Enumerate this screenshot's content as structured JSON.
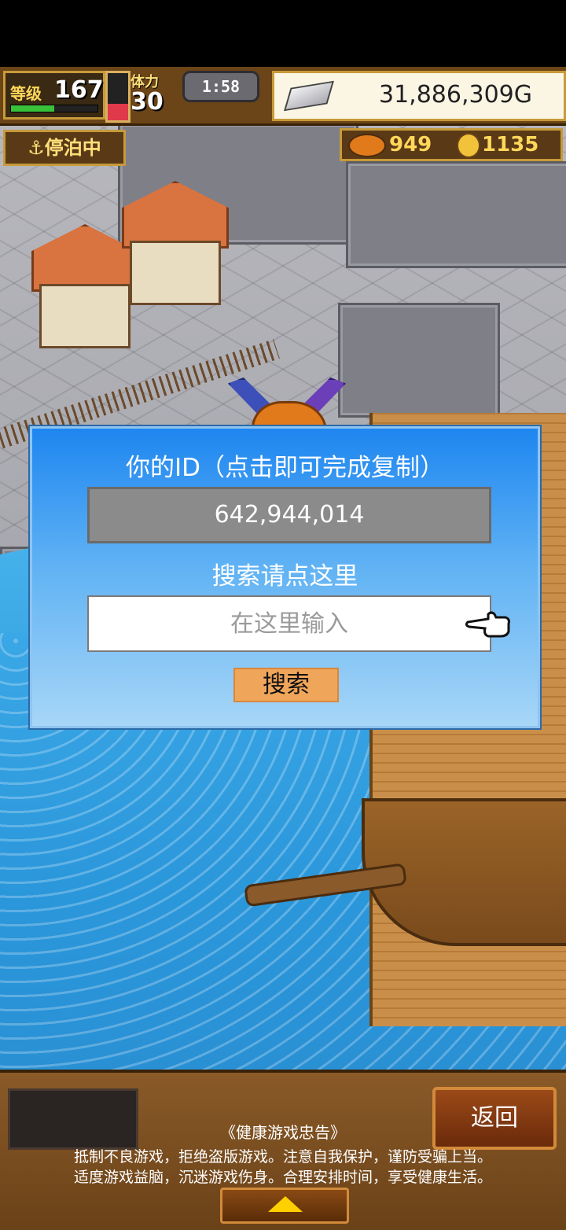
{
  "hud": {
    "level_label": "等级",
    "level_value": "167",
    "level_progress": 0.5,
    "hp_fraction": 0.35,
    "stamina_label": "体力",
    "stamina_value": "30",
    "timer": "1:58",
    "gold": "31,886,309G",
    "status": "停泊中",
    "medals": "949",
    "coins": "1135"
  },
  "dialog": {
    "title": "你的ID（点击即可完成复制）",
    "id_value": "642,944,014",
    "search_label": "搜索请点这里",
    "input_placeholder": "在这里输入",
    "search_button": "搜索"
  },
  "bottom": {
    "back_button": "返回",
    "advisory_title": "《健康游戏忠告》",
    "advisory_line1": "抵制不良游戏，拒绝盗版游戏。注意自我保护，谨防受骗上当。",
    "advisory_line2": "适度游戏益脑，沉迷游戏伤身。合理安排时间，享受健康生活。"
  },
  "colors": {
    "dialog_top": "#1e86f0",
    "search_button": "#f0a65a",
    "hud_brown": "#6b4418"
  }
}
